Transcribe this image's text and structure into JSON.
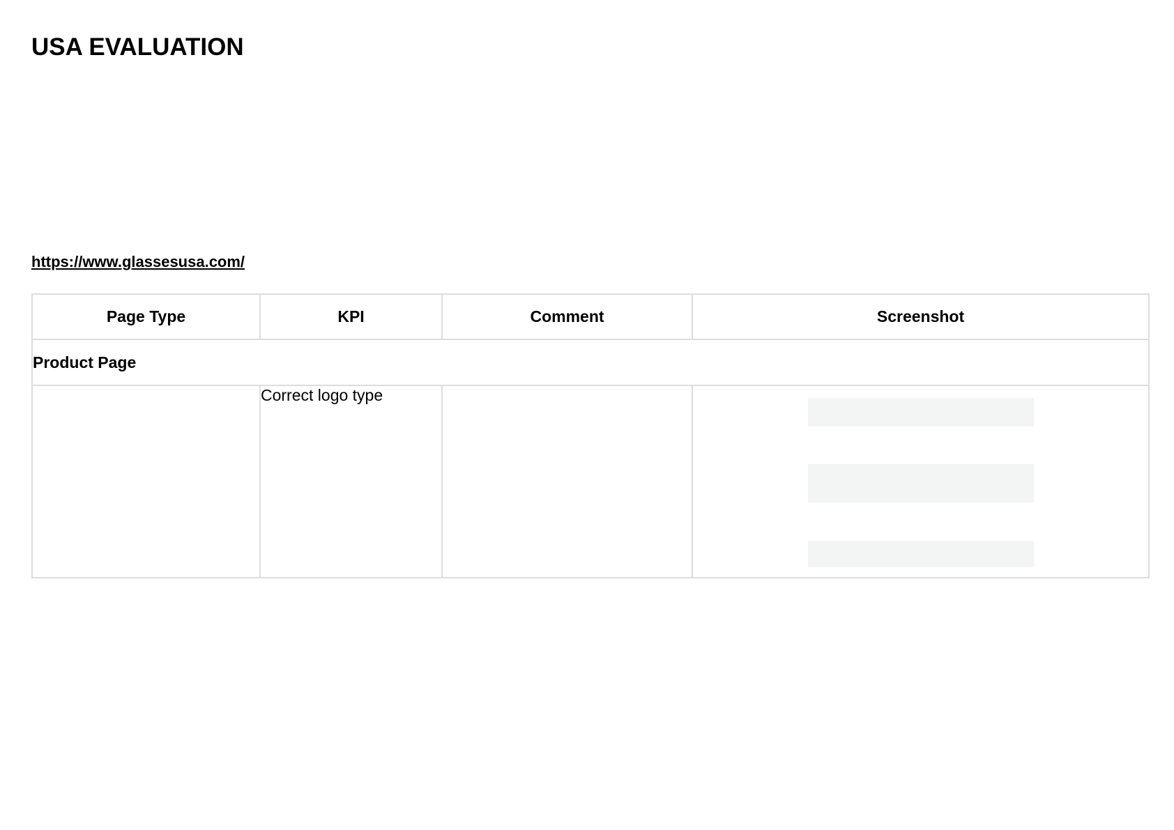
{
  "document": {
    "title": "USA EVALUATION",
    "url": "https://www.glassesusa.com/"
  },
  "table": {
    "headers": [
      "Page Type",
      "KPI",
      "Comment",
      "Screenshot"
    ],
    "section": "Product Page",
    "rows": [
      {
        "page_type": "",
        "kpi": "Correct logo type",
        "comment": "",
        "screenshot": "placeholder-blocks"
      }
    ]
  },
  "colors": {
    "border": "#dddddd",
    "placeholder": "#f3f4f4",
    "text": "#000000"
  }
}
